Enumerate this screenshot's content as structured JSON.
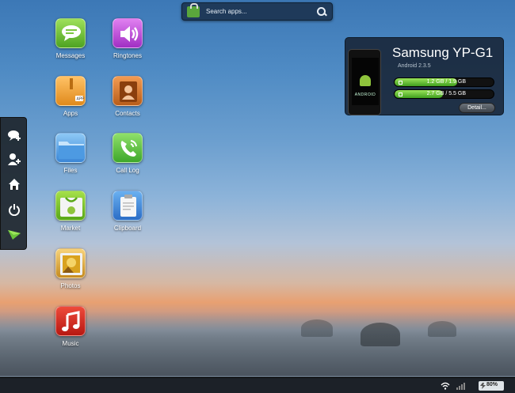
{
  "search": {
    "placeholder": "Search apps..."
  },
  "apps": [
    {
      "label": "Messages"
    },
    {
      "label": "Ringtones"
    },
    {
      "label": "Apps"
    },
    {
      "label": "Contacts"
    },
    {
      "label": "Files"
    },
    {
      "label": "Call Log"
    },
    {
      "label": "Market"
    },
    {
      "label": "Clipboard"
    },
    {
      "label": "Photos"
    },
    {
      "label": "Music"
    }
  ],
  "device": {
    "name": "Samsung YP-G1",
    "android_version": "Android 2.3.5",
    "storage": [
      {
        "text": "1.2 GB / 1.9 GB",
        "fill": 0.63
      },
      {
        "text": "2.7 GB / 5.5 GB",
        "fill": 0.49
      }
    ],
    "detail_label": "Detail...",
    "phone_label": "ANDROID"
  },
  "status": {
    "battery": "80%"
  },
  "colors": {
    "accent": "#3f9e1e",
    "panel": "#182638",
    "statusbar": "#1c2128"
  }
}
